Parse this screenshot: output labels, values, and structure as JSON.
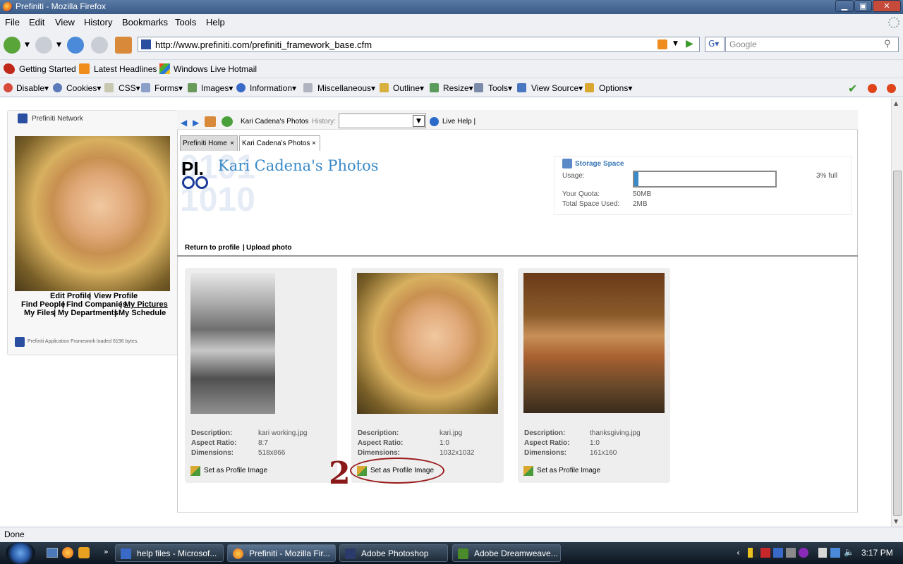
{
  "window": {
    "title": "Prefiniti - Mozilla Firefox"
  },
  "menu": [
    "File",
    "Edit",
    "View",
    "History",
    "Bookmarks",
    "Tools",
    "Help"
  ],
  "nav": {
    "url": "http://www.prefiniti.com/prefiniti_framework_base.cfm",
    "search_placeholder": "Google"
  },
  "bookmarks": [
    "Getting Started",
    "Latest Headlines",
    "Windows Live Hotmail"
  ],
  "devtoolbar": [
    "Disable",
    "Cookies",
    "CSS",
    "Forms",
    "Images",
    "Information",
    "Miscellaneous",
    "Outline",
    "Resize",
    "Tools",
    "View Source",
    "Options"
  ],
  "sidebar": {
    "network_label": "Prefiniti Network",
    "profile_links": {
      "edit": "Edit Profile",
      "view": "View Profile"
    },
    "links_row2": {
      "find_people": "Find People",
      "find_companies": "Find Companies",
      "my_pictures": "My Pictures"
    },
    "links_row3": {
      "my_files": "My Files",
      "my_departments": "My Departments",
      "my_schedule": "My Schedule"
    },
    "footer": "Prefiniti Application Framework loaded 6196 bytes."
  },
  "app": {
    "breadcrumb": "Kari Cadena's Photos",
    "history_label": "History:",
    "live_help": "Live Help |",
    "tabs": [
      "Prefiniti Home",
      "Kari Cadena's Photos"
    ],
    "page_title": "Kari Cadena's Photos",
    "logo_text": "PI.",
    "return_link": "Return to profile",
    "upload_link": "Upload photo"
  },
  "storage": {
    "title": "Storage Space",
    "usage_label": "Usage:",
    "usage_fraction": 0.03,
    "usage_text": "3% full",
    "quota_label": "Your Quota:",
    "quota_value": "50MB",
    "used_label": "Total Space Used:",
    "used_value": "2MB"
  },
  "photos": [
    {
      "description": "kari working.jpg",
      "aspect": "8:7",
      "dimensions": "518x866",
      "action": "Set as Profile Image"
    },
    {
      "description": "kari.jpg",
      "aspect": "1:0",
      "dimensions": "1032x1032",
      "action": "Set as Profile Image"
    },
    {
      "description": "thanksgiving.jpg",
      "aspect": "1:0",
      "dimensions": "161x160",
      "action": "Set as Profile Image"
    }
  ],
  "labels": {
    "description": "Description:",
    "aspect": "Aspect Ratio:",
    "dimensions": "Dimensions:"
  },
  "annotation": {
    "number": "2"
  },
  "status": {
    "text": "Done"
  },
  "taskbar": {
    "tasks": [
      "help files - Microsof...",
      "Prefiniti - Mozilla Fir...",
      "Adobe Photoshop",
      "Adobe Dreamweave..."
    ],
    "clock": "3:17 PM"
  }
}
